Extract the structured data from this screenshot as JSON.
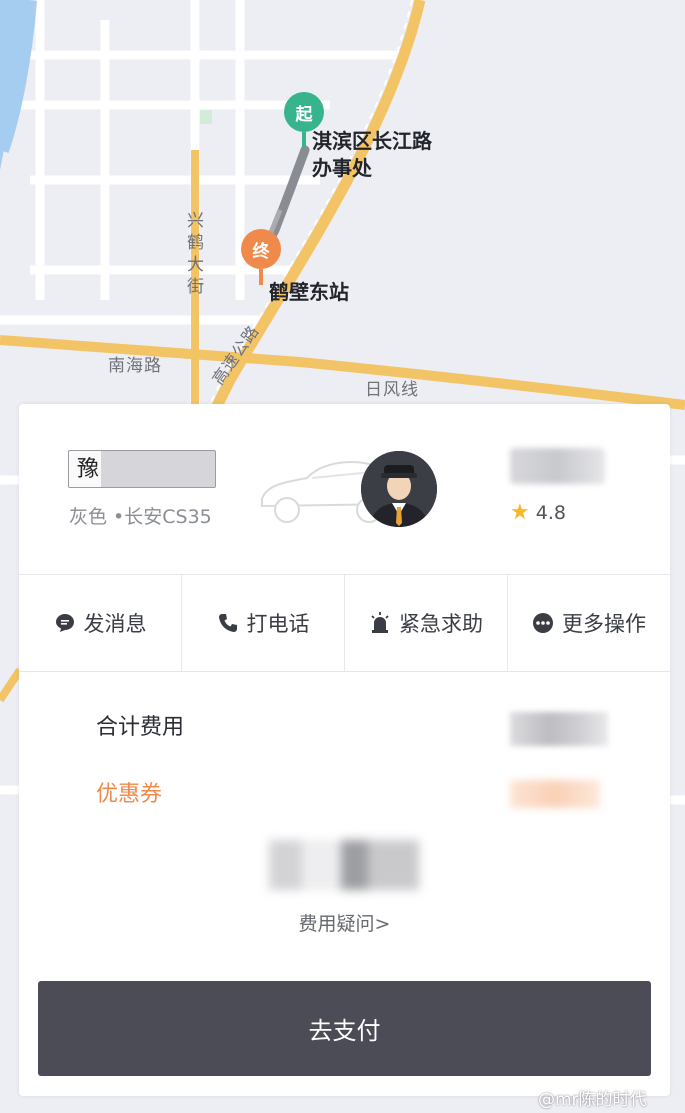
{
  "map": {
    "start_marker": "起",
    "end_marker": "终",
    "start_place": "淇滨区长江路\n办事处",
    "start_place_line1": "淇滨区长江路",
    "start_place_line2": "办事处",
    "end_place": "鹤壁东站",
    "road_xinghe": "兴鹤大街",
    "road_nanhai": "南海路",
    "road_rifeng": "日风线",
    "road_highway": "高速公路"
  },
  "driver": {
    "plate_prefix": "豫",
    "car_description": "灰色 •长安CS35",
    "rating": "4.8",
    "avatar_icon": "driver-avatar-icon",
    "car_icon": "car-outline-icon"
  },
  "actions": [
    {
      "label": "发消息",
      "icon": "message-icon"
    },
    {
      "label": "打电话",
      "icon": "phone-icon"
    },
    {
      "label": "紧急求助",
      "icon": "alarm-icon"
    },
    {
      "label": "更多操作",
      "icon": "more-icon"
    }
  ],
  "fees": {
    "total_label": "合计费用",
    "coupon_label": "优惠券",
    "question_label": "费用疑问>"
  },
  "pay_button_label": "去支付",
  "watermark": "@mr陈的时代",
  "colors": {
    "start_green": "#37b48c",
    "end_orange": "#f08a4b",
    "coupon_orange": "#f08a4b",
    "pay_button": "#4c4c57",
    "road_yellow": "#f3c466",
    "river_blue": "#a5cdf0"
  }
}
